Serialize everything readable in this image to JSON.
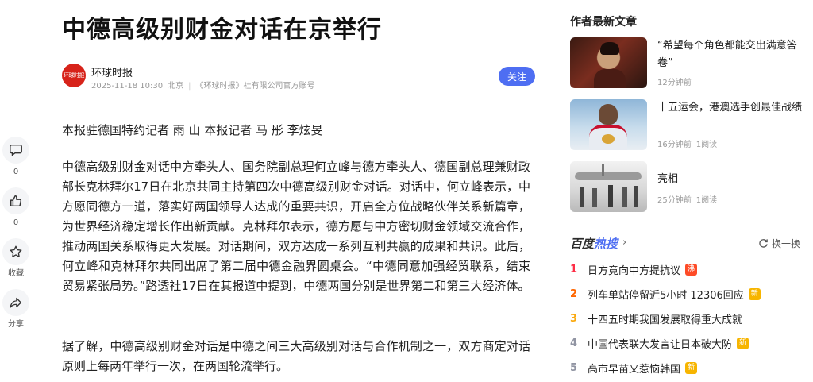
{
  "article": {
    "title": "中德高级别财金对话在京举行",
    "author": {
      "avatar_text": "环球时报",
      "name": "环球时报",
      "date": "2025-11-18 10:30",
      "location": "北京",
      "separator": "|",
      "account": "《环球时报》社有限公司官方账号",
      "follow_label": "关注"
    },
    "byline": "本报驻德国特约记者 雨 山 本报记者 马 彤 李炫旻",
    "paragraphs": [
      "中德高级别财金对话中方牵头人、国务院副总理何立峰与德方牵头人、德国副总理兼财政部长克林拜尔17日在北京共同主持第四次中德高级别财金对话。对话中，何立峰表示，中方愿同德方一道，落实好两国领导人达成的重要共识，开启全方位战略伙伴关系新篇章，为世界经济稳定增长作出新贡献。克林拜尔表示，德方愿与中方密切财金领域交流合作，推动两国关系取得更大发展。对话期间，双方达成一系列互利共赢的成果和共识。此后，何立峰和克林拜尔共同出席了第二届中德金融界圆桌会。“中德同意加强经贸联系，结束贸易紧张局势。”路透社17日在其报道中提到，中德两国分别是世界第二和第三大经济体。",
      "据了解，中德高级别财金对话是中德之间三大高级别对话与合作机制之一，双方商定对话原则上每两年举行一次，在两国轮流举行。"
    ]
  },
  "rail": [
    {
      "icon": "comment-icon",
      "label": "0"
    },
    {
      "icon": "like-icon",
      "label": "0"
    },
    {
      "icon": "star-icon",
      "label": "收藏"
    },
    {
      "icon": "share-icon",
      "label": "分享"
    }
  ],
  "sidebar": {
    "heading": "作者最新文章",
    "articles": [
      {
        "title": "“希望每个角色都能交出满意答卷”",
        "time": "12分钟前",
        "reads": ""
      },
      {
        "title": "十五运会，港澳选手创最佳战绩",
        "time": "16分钟前",
        "reads": "1阅读"
      },
      {
        "title": "亮相",
        "time": "25分钟前",
        "reads": "1阅读"
      }
    ],
    "hot": {
      "logo_a": "百度",
      "logo_b": "热搜",
      "refresh_label": "换一换",
      "items": [
        {
          "rank": "1",
          "text": "日方竟向中方提抗议",
          "tag": "沸",
          "tag_color": "#fe4b27",
          "rank_color": "#fe2d46"
        },
        {
          "rank": "2",
          "text": "列车单站停留近5小时 12306回应",
          "tag": "新",
          "tag_color": "#f7b500",
          "rank_color": "#f60"
        },
        {
          "rank": "3",
          "text": "十四五时期我国发展取得重大成就",
          "tag": "",
          "tag_color": "",
          "rank_color": "#faa90e"
        },
        {
          "rank": "4",
          "text": "中国代表联大发言让日本破大防",
          "tag": "新",
          "tag_color": "#f7b500",
          "rank_color": "#9195a3"
        },
        {
          "rank": "5",
          "text": "高市早苗又惹恼韩国",
          "tag": "新",
          "tag_color": "#f7b500",
          "rank_color": "#9195a3"
        }
      ]
    }
  },
  "colors": {
    "accent": "#4e6ef2",
    "brand_red": "#d7231a"
  }
}
